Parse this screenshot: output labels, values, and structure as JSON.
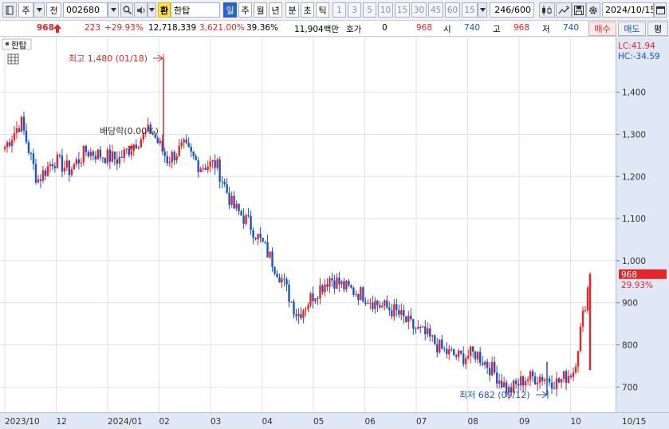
{
  "toolbar": {
    "market": "주",
    "prefix": "전",
    "code": "002680",
    "badge": "환",
    "stock_name": "한탑",
    "periods": [
      "일",
      "주",
      "월",
      "년",
      "분",
      "초",
      "틱"
    ],
    "selected_period": "일",
    "intervals": [
      "1",
      "3",
      "5",
      "10",
      "15",
      "30",
      "45",
      "60"
    ],
    "interval_value": "15",
    "count": "246",
    "count_total": "/600",
    "date": "2024/10/15"
  },
  "quote": {
    "price": "968",
    "change": "223",
    "change_pct": "+29.93%",
    "volume": "12,718,339",
    "volume_ratio": "3,621.00%",
    "turnover": "39.36%",
    "amount": "11,904백만",
    "hoga_label": "호가",
    "hoga_value": "0",
    "hoga_price": "968",
    "open_label": "시",
    "open": "740",
    "high_label": "고",
    "high": "968",
    "low_label": "저",
    "low": "740",
    "buy_label": "매수",
    "sell_label": "매도",
    "avg_label": "평"
  },
  "chart": {
    "legend_name": "한탑",
    "high_annotation": "최고 1,480 (01/18)",
    "low_annotation": "최저 682 (09/12)",
    "dividend_annotation": "배당락(0.00%)",
    "lc_label": "LC:41.94",
    "hc_label": "HC:-34.59",
    "current_price_label": "968",
    "current_pct_label": "29.93%",
    "up_color": "#e3262c",
    "down_color": "#1b53c7"
  },
  "chart_data": {
    "type": "candlestick",
    "y_ticks": [
      "700",
      "800",
      "900",
      "1,000",
      "1,100",
      "1,200",
      "1,300",
      "1,400"
    ],
    "x_ticks": [
      "2023/10",
      "12",
      "2024/01",
      "02",
      "03",
      "04",
      "05",
      "06",
      "07",
      "08",
      "09",
      "10",
      "10/15"
    ],
    "ylim": [
      640,
      1530
    ],
    "grid": true,
    "high": 1480,
    "low": 682,
    "last": 968,
    "anchors": [
      {
        "date": "2023/10",
        "close": 1270
      },
      {
        "date": "2023/10",
        "close": 1330
      },
      {
        "date": "2023/11",
        "close": 1190
      },
      {
        "date": "2023/11",
        "close": 1240
      },
      {
        "date": "2023/11",
        "close": 1215
      },
      {
        "date": "2023/12",
        "close": 1260
      },
      {
        "date": "2023/12",
        "close": 1250
      },
      {
        "date": "2023/12",
        "close": 1240
      },
      {
        "date": "2024/01",
        "close": 1280
      },
      {
        "date": "2024/01",
        "close": 1310
      },
      {
        "date": "2024/01",
        "close": 1240
      },
      {
        "date": "2024/02",
        "close": 1270
      },
      {
        "date": "2024/02",
        "close": 1225
      },
      {
        "date": "2024/02",
        "close": 1230
      },
      {
        "date": "2024/03",
        "close": 1130
      },
      {
        "date": "2024/03",
        "close": 1090
      },
      {
        "date": "2024/04",
        "close": 1030
      },
      {
        "date": "2024/04",
        "close": 960
      },
      {
        "date": "2024/04",
        "close": 870
      },
      {
        "date": "2024/05",
        "close": 920
      },
      {
        "date": "2024/05",
        "close": 960
      },
      {
        "date": "2024/05",
        "close": 935
      },
      {
        "date": "2024/06",
        "close": 920
      },
      {
        "date": "2024/06",
        "close": 895
      },
      {
        "date": "2024/07",
        "close": 880
      },
      {
        "date": "2024/07",
        "close": 845
      },
      {
        "date": "2024/07",
        "close": 820
      },
      {
        "date": "2024/08",
        "close": 785
      },
      {
        "date": "2024/08",
        "close": 770
      },
      {
        "date": "2024/08",
        "close": 780
      },
      {
        "date": "2024/09",
        "close": 740
      },
      {
        "date": "2024/09",
        "close": 690
      },
      {
        "date": "2024/09",
        "close": 720
      },
      {
        "date": "2024/10",
        "close": 725
      },
      {
        "date": "2024/10",
        "close": 710
      },
      {
        "date": "2024/10",
        "close": 740
      },
      {
        "date": "2024/10/15",
        "close": 968
      }
    ]
  }
}
